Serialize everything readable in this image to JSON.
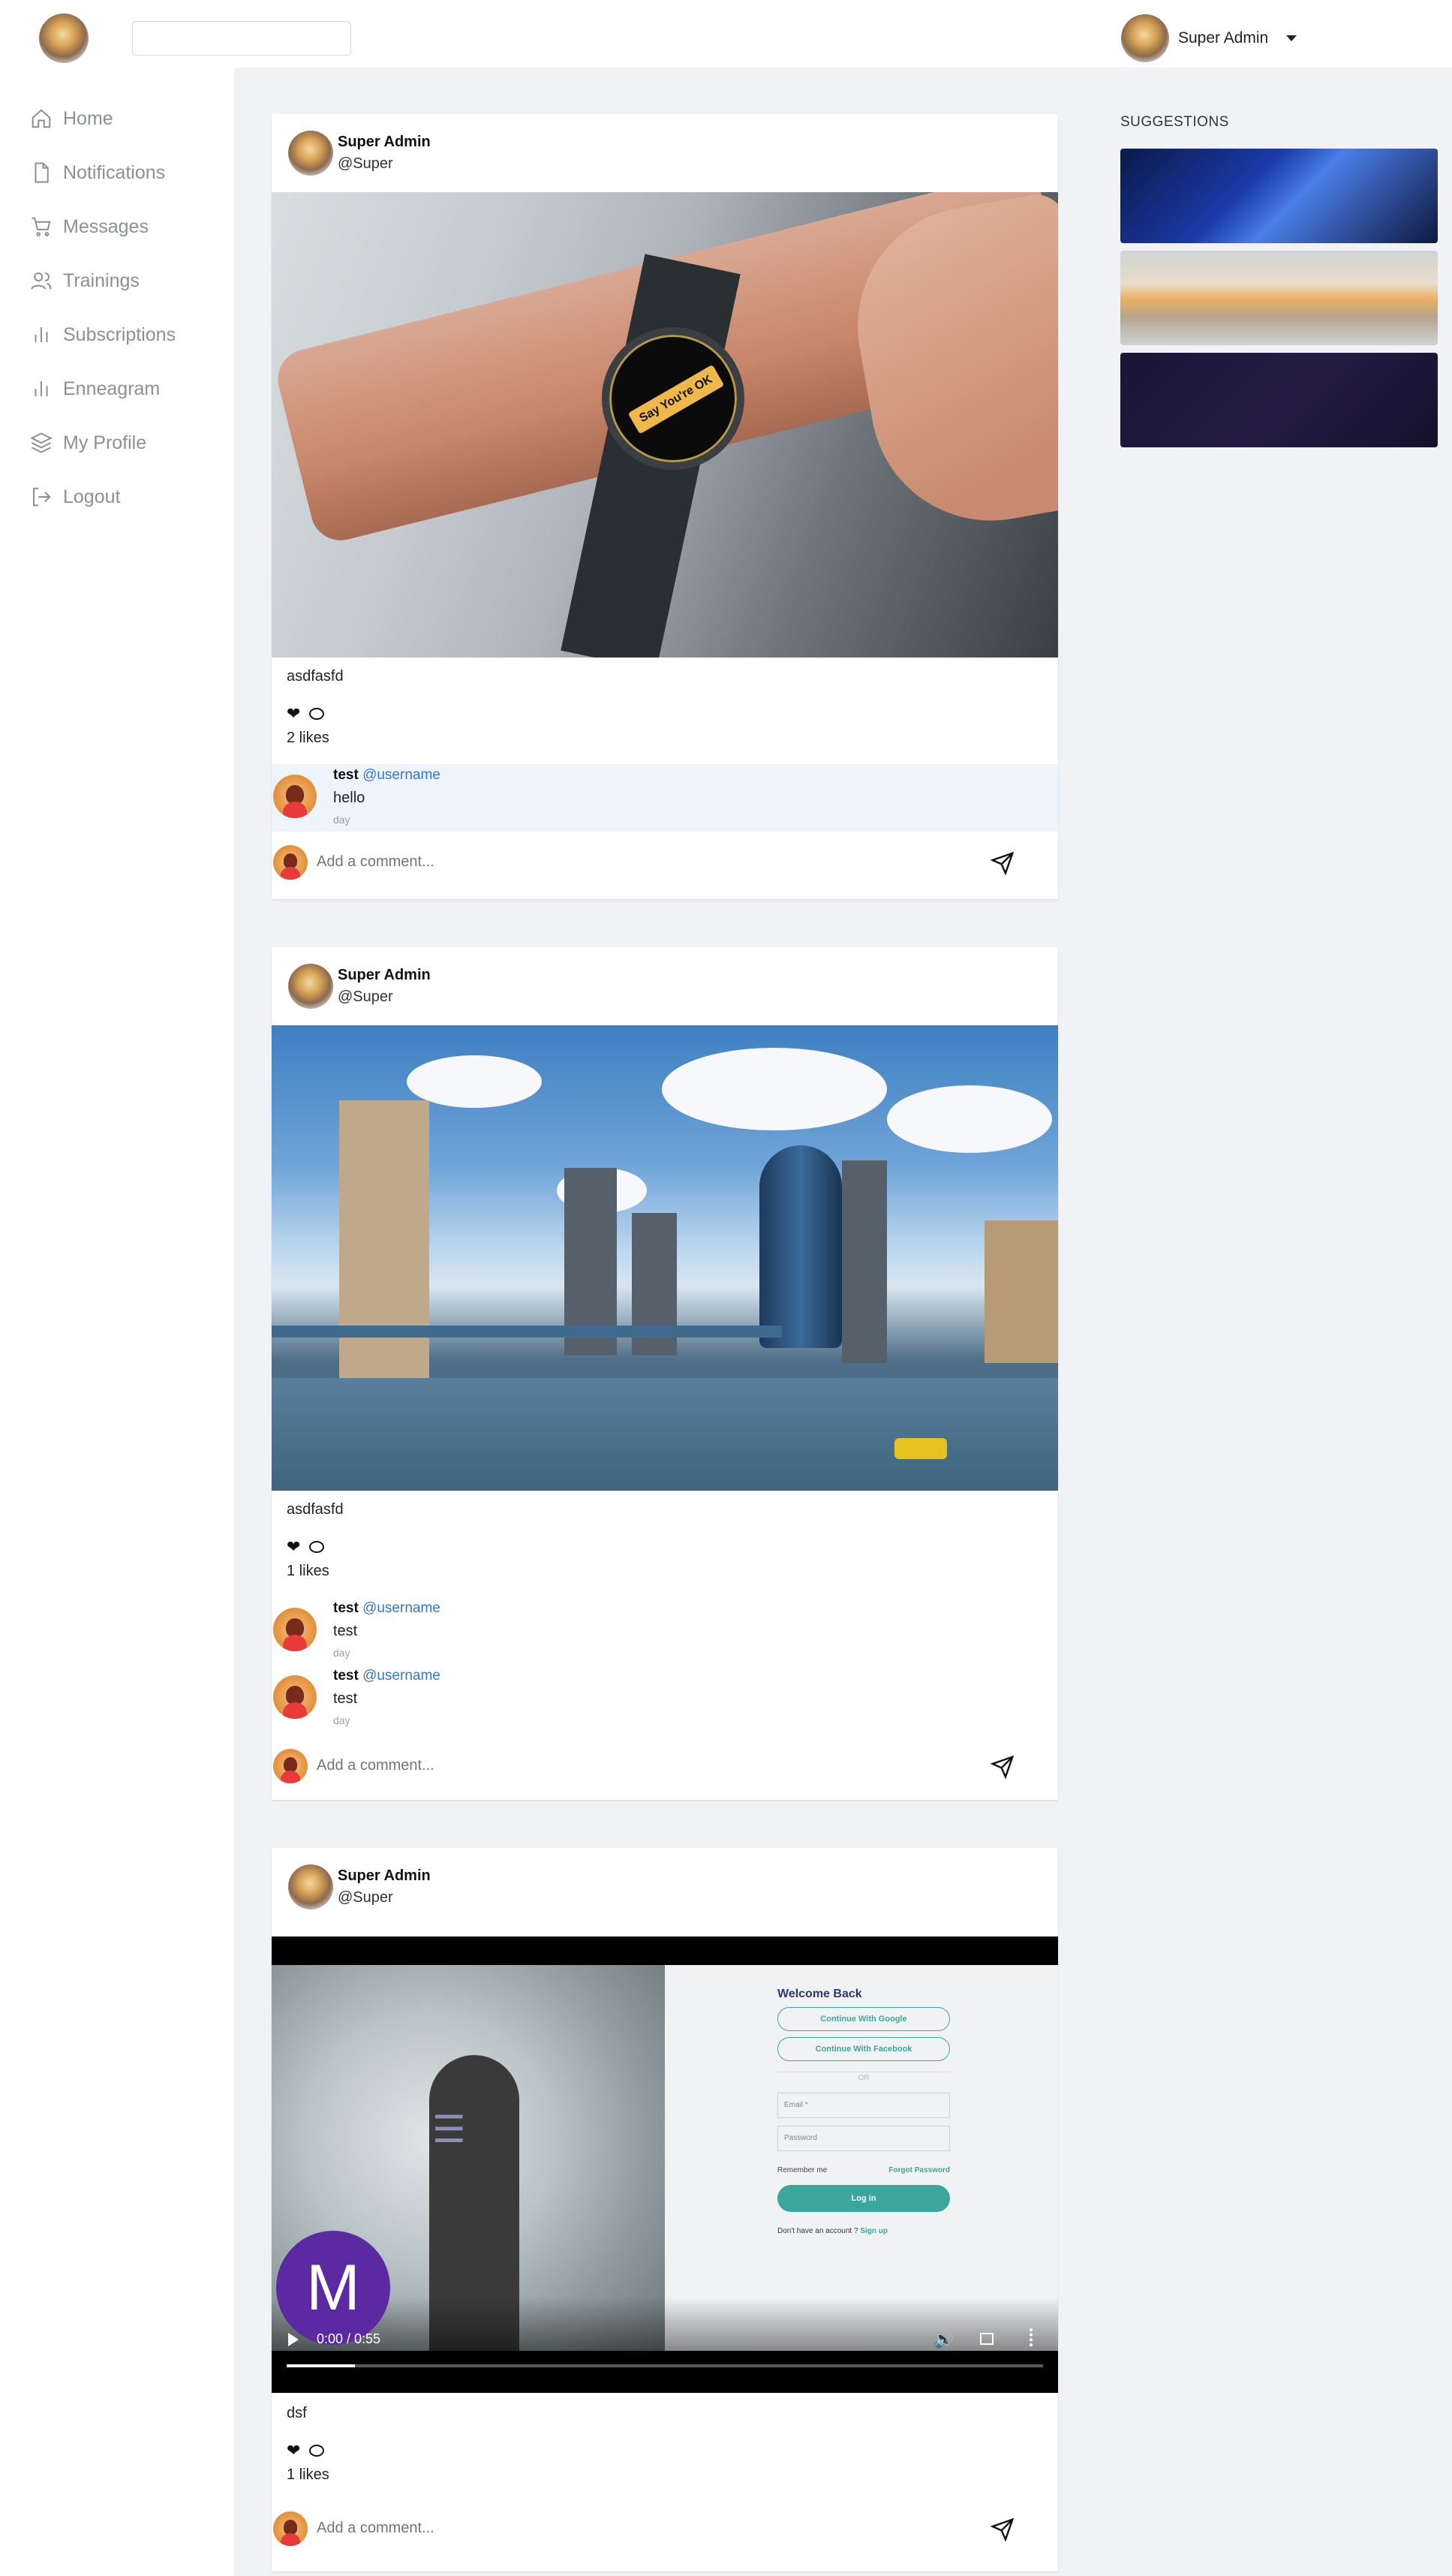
{
  "topbar": {
    "search_value": "",
    "user_name": "Super Admin"
  },
  "sidebar": {
    "items": [
      {
        "label": "Home",
        "icon": "home-icon"
      },
      {
        "label": "Notifications",
        "icon": "document-icon"
      },
      {
        "label": "Messages",
        "icon": "cart-icon"
      },
      {
        "label": "Trainings",
        "icon": "users-icon"
      },
      {
        "label": "Subscriptions",
        "icon": "bar-chart-icon"
      },
      {
        "label": "Enneagram",
        "icon": "bar-chart-icon"
      },
      {
        "label": "My Profile",
        "icon": "layers-icon"
      },
      {
        "label": "Logout",
        "icon": "logout-icon"
      }
    ]
  },
  "comment_placeholder": "Add a comment...",
  "posts": [
    {
      "author": "Super Admin",
      "handle": "@Super",
      "caption": "asdfasfd",
      "likes": "2 likes",
      "image_text": "Say You're OK",
      "comments": [
        {
          "user": "test",
          "mention": "@username",
          "text": "hello",
          "time": "day"
        }
      ]
    },
    {
      "author": "Super Admin",
      "handle": "@Super",
      "caption": "asdfasfd",
      "likes": "1 likes",
      "comments": [
        {
          "user": "test",
          "mention": "@username",
          "text": "test",
          "time": "day"
        },
        {
          "user": "test",
          "mention": "@username",
          "text": "test",
          "time": "day"
        }
      ]
    },
    {
      "author": "Super Admin",
      "handle": "@Super",
      "caption": "dsf",
      "likes": "1 likes",
      "video": {
        "time": "0:00 / 0:55",
        "progress": 0.09,
        "avatar_letter": "M",
        "login": {
          "title": "Welcome Back",
          "google": "Continue With Google",
          "facebook": "Continue With Facebook",
          "or": "OR",
          "email": "Email *",
          "password": "Password",
          "remember": "Remember me",
          "forgot": "Forgot Password",
          "login_btn": "Log in",
          "no_account": "Don't have an account ?",
          "signup": "Sign up"
        }
      },
      "comments": []
    }
  ],
  "suggestions": {
    "title": "SUGGESTIONS"
  }
}
